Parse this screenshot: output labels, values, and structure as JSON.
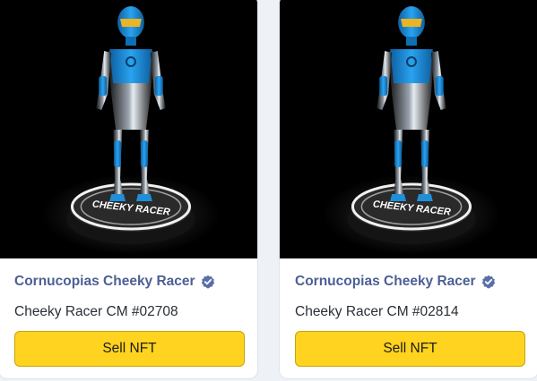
{
  "cards": [
    {
      "collection": "Cornucopias Cheeky Racer",
      "name": "Cheeky Racer CM #02708",
      "button": "Sell NFT",
      "pedestal_text": "CHEEKY RACER"
    },
    {
      "collection": "Cornucopias Cheeky Racer",
      "name": "Cheeky Racer CM #02814",
      "button": "Sell NFT",
      "pedestal_text": "CHEEKY RACER"
    }
  ],
  "colors": {
    "button_bg": "#ffd31f",
    "collection_text": "#4d6095",
    "verified_badge": "#5a6fa8",
    "suit_blue": "#1e8fd8"
  },
  "icons": {
    "verified": "verified-badge-icon"
  }
}
